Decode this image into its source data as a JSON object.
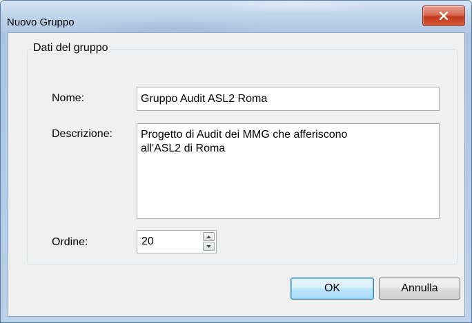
{
  "window": {
    "title": "Nuovo Gruppo",
    "close_icon": "close-x-icon"
  },
  "group": {
    "label": "Dati del gruppo",
    "nome_label": "Nome:",
    "nome_value": "Gruppo Audit ASL2 Roma",
    "descrizione_label": "Descrizione:",
    "descrizione_value": "Progetto di Audit dei MMG che afferiscono\nall'ASL2 di Roma",
    "ordine_label": "Ordine:",
    "ordine_value": "20"
  },
  "buttons": {
    "ok": "OK",
    "cancel": "Annulla"
  },
  "colors": {
    "close_button": "#c2371c",
    "default_button_border": "#3c7fb1"
  }
}
